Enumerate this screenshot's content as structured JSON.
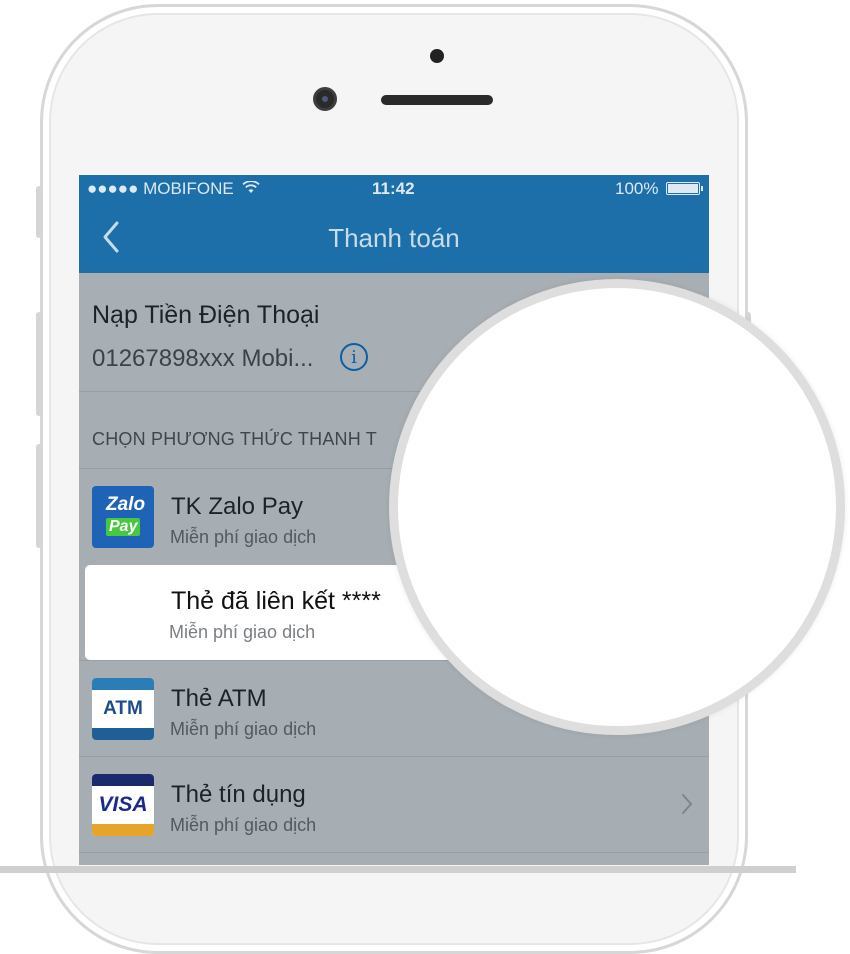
{
  "status_bar": {
    "carrier": "●●●●● MOBIFONE",
    "time": "11:42",
    "battery": "100%"
  },
  "nav": {
    "title": "Thanh toán",
    "back_icon": "chevron-left-icon"
  },
  "summary": {
    "title": "Nạp Tiền Điện Thoại",
    "subtitle": "01267898xxx Mobi...",
    "info_icon": "info-icon",
    "info_glyph": "i"
  },
  "section_header": "CHỌN PHƯƠNG THỨC THANH T",
  "methods": [
    {
      "title": "TK Zalo Pay",
      "subtitle": "Miễn phí giao dịch",
      "icon": "zalopay-icon",
      "logo_line1": "Zalo",
      "logo_line2": "Pay"
    },
    {
      "title": "Thẻ đã liên kết ****",
      "subtitle": "Miễn phí giao dịch",
      "selected": true
    },
    {
      "title": "Thẻ ATM",
      "subtitle": "Miễn phí giao dịch",
      "icon": "atm-card-icon",
      "logo": "ATM"
    },
    {
      "title": "Thẻ tín dụng",
      "subtitle": "Miễn phí giao dịch",
      "icon": "visa-card-icon",
      "logo": "VISA"
    }
  ],
  "colors": {
    "nav_blue": "#1c6fa8",
    "screen_dim": "#a6aeb3",
    "info_blue": "#0a5fa5",
    "zalo_blue": "#1e63b5",
    "zalo_green": "#48c83f",
    "visa_gold": "#e6a52a"
  }
}
